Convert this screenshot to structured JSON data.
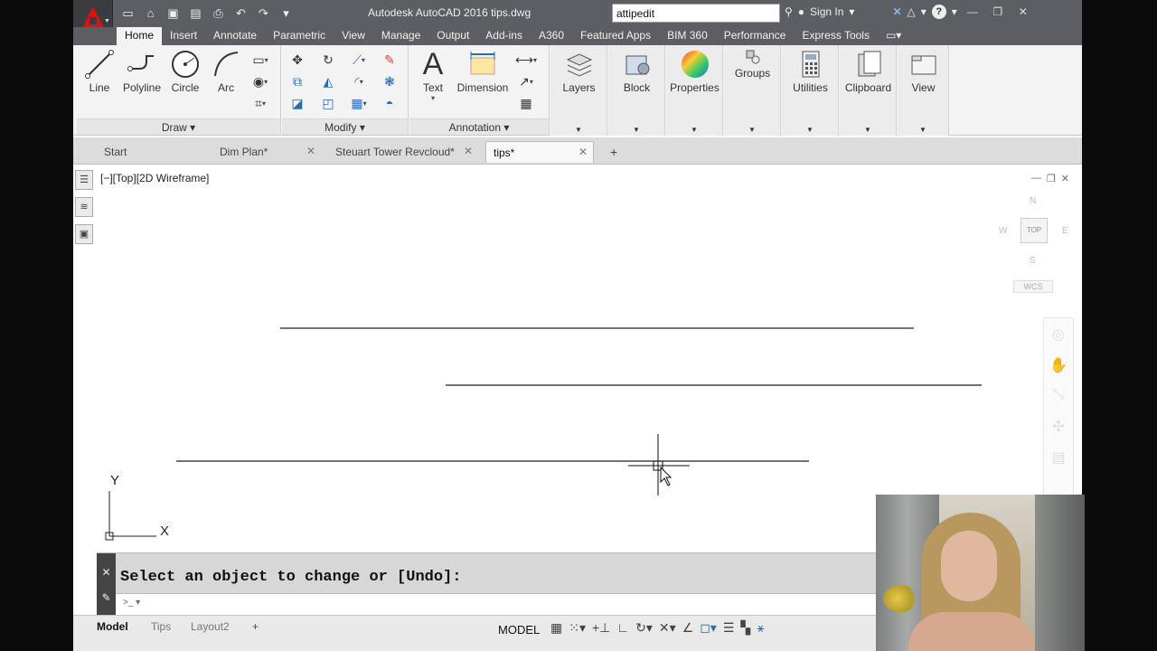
{
  "window": {
    "title": "Autodesk AutoCAD 2016    tips.dwg",
    "search_value": "attipedit",
    "sign_in": "Sign In"
  },
  "ribbon_tabs": [
    "Home",
    "Insert",
    "Annotate",
    "Parametric",
    "View",
    "Manage",
    "Output",
    "Add-ins",
    "A360",
    "Featured Apps",
    "BIM 360",
    "Performance",
    "Express Tools"
  ],
  "ribbon": {
    "draw": {
      "title": "Draw",
      "buttons": [
        "Line",
        "Polyline",
        "Circle",
        "Arc"
      ]
    },
    "modify": {
      "title": "Modify"
    },
    "annotation": {
      "title": "Annotation",
      "buttons": [
        "Text",
        "Dimension"
      ]
    },
    "layers": "Layers",
    "block": "Block",
    "properties": "Properties",
    "groups": "Groups",
    "utilities": "Utilities",
    "clipboard": "Clipboard",
    "view": "View"
  },
  "file_tabs": [
    "Start",
    "Dim Plan*",
    "Steuart Tower Revcloud*",
    "tips*"
  ],
  "viewport": {
    "label": "[−][Top][2D Wireframe]",
    "viewcube": {
      "n": "N",
      "w": "W",
      "e": "E",
      "s": "S",
      "top": "TOP",
      "wcs": "WCS"
    },
    "ucs": {
      "x": "X",
      "y": "Y"
    }
  },
  "command": {
    "prompt": "Select an object to change or [Undo]:"
  },
  "status": {
    "layout_tabs": [
      "Model",
      "Tips",
      "Layout2"
    ],
    "model": "MODEL"
  }
}
